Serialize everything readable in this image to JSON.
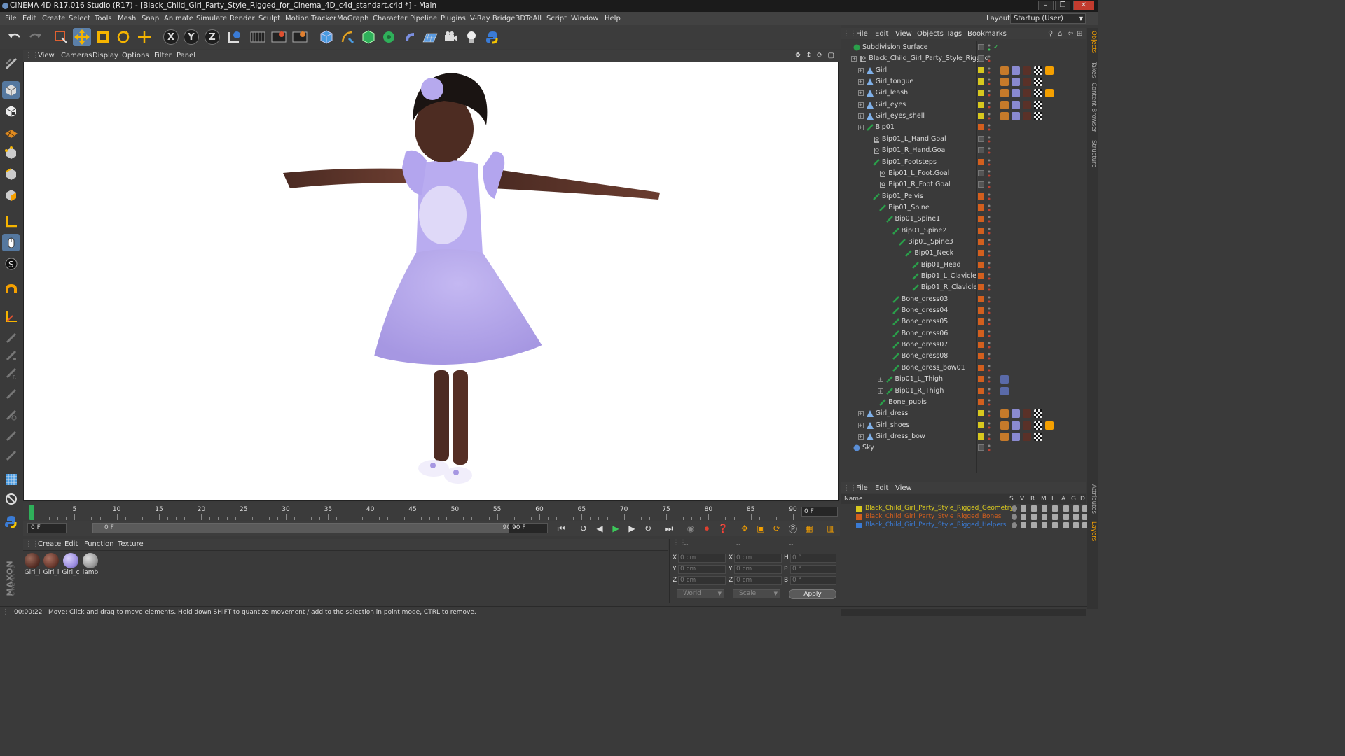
{
  "window": {
    "title": "CINEMA 4D R17.016 Studio (R17) - [Black_Child_Girl_Party_Style_Rigged_for_Cinema_4D_c4d_standart.c4d *] - Main",
    "minimize": "–",
    "maximize": "❐",
    "close": "✕"
  },
  "menubar": {
    "items": [
      "File",
      "Edit",
      "Create",
      "Select",
      "Tools",
      "Mesh",
      "Snap",
      "Animate",
      "Simulate",
      "Render",
      "Sculpt",
      "Motion Tracker",
      "MoGraph",
      "Character",
      "Pipeline",
      "Plugins",
      "V-Ray Bridge",
      "3DToAll",
      "Script",
      "Window",
      "Help"
    ],
    "layout_label": "Layout:",
    "layout_value": "Startup (User)"
  },
  "toolbar": {
    "axis_x": "X",
    "axis_y": "Y",
    "axis_z": "Z"
  },
  "viewport": {
    "menu": [
      "View",
      "Cameras",
      "Display",
      "Options",
      "Filter",
      "Panel"
    ]
  },
  "timeline": {
    "tick_labels": [
      "0",
      "5",
      "10",
      "15",
      "20",
      "25",
      "30",
      "35",
      "40",
      "45",
      "50",
      "55",
      "60",
      "65",
      "70",
      "75",
      "80",
      "85",
      "90"
    ],
    "current_frame": "0 F",
    "start_frame": "0 F",
    "range_start": "0 F",
    "range_end": "90 F",
    "end_frame": "90 F"
  },
  "material_manager": {
    "menu": [
      "Create",
      "Edit",
      "Function",
      "Texture"
    ],
    "materials": [
      {
        "label": "Girl_l",
        "color": "#5a3128"
      },
      {
        "label": "Girl_l",
        "color": "#6b3a2f"
      },
      {
        "label": "Girl_c",
        "color": "#9d8fe0"
      },
      {
        "label": "lamb",
        "color": "#9a9a9a"
      }
    ]
  },
  "coordinates": {
    "header": [
      "--",
      "--",
      "--"
    ],
    "rows": [
      {
        "a": "X",
        "av": "0 cm",
        "b": "X",
        "bv": "0 cm",
        "c": "H",
        "cv": "0 °"
      },
      {
        "a": "Y",
        "av": "0 cm",
        "b": "Y",
        "bv": "0 cm",
        "c": "P",
        "cv": "0 °"
      },
      {
        "a": "Z",
        "av": "0 cm",
        "b": "Z",
        "bv": "0 cm",
        "c": "B",
        "cv": "0 °"
      }
    ],
    "mode_world": "World",
    "mode_scale": "Scale",
    "apply": "Apply"
  },
  "status": {
    "time": "00:00:22",
    "message": "Move: Click and drag to move elements. Hold down SHIFT to quantize movement / add to the selection in point mode, CTRL to remove."
  },
  "object_manager": {
    "menu": [
      "File",
      "Edit",
      "View",
      "Objects",
      "Tags",
      "Bookmarks"
    ],
    "objects": [
      {
        "name": "Subdivision Surface",
        "indent": 0,
        "icon": "subdivision-icon",
        "color": "#2a9f4a",
        "layer": "none",
        "check": true
      },
      {
        "name": "Black_Child_Girl_Party_Style_Rigged",
        "indent": 1,
        "icon": "null-icon",
        "color": "#cfcfcf",
        "layer": "none"
      },
      {
        "name": "Girl",
        "indent": 2,
        "icon": "polygon-icon",
        "color": "#7fb0e8",
        "layer": "#d8c81e",
        "tags": 5
      },
      {
        "name": "Girl_tongue",
        "indent": 2,
        "icon": "polygon-icon",
        "color": "#7fb0e8",
        "layer": "#d8c81e",
        "tags": 4
      },
      {
        "name": "Girl_leash",
        "indent": 2,
        "icon": "polygon-icon",
        "color": "#7fb0e8",
        "layer": "#d8c81e",
        "tags": 5
      },
      {
        "name": "Girl_eyes",
        "indent": 2,
        "icon": "polygon-icon",
        "color": "#7fb0e8",
        "layer": "#d8c81e",
        "tags": 4
      },
      {
        "name": "Girl_eyes_shell",
        "indent": 2,
        "icon": "polygon-icon",
        "color": "#7fb0e8",
        "layer": "#d8c81e",
        "tags": 4
      },
      {
        "name": "Bip01",
        "indent": 2,
        "icon": "bone-icon",
        "color": "#2a9f4a",
        "layer": "#d35f1e"
      },
      {
        "name": "Bip01_L_Hand.Goal",
        "indent": 3,
        "icon": "null-icon",
        "color": "#cfcfcf",
        "layer": "none"
      },
      {
        "name": "Bip01_R_Hand.Goal",
        "indent": 3,
        "icon": "null-icon",
        "color": "#cfcfcf",
        "layer": "none"
      },
      {
        "name": "Bip01_Footsteps",
        "indent": 3,
        "icon": "bone-icon",
        "color": "#2a9f4a",
        "layer": "#d35f1e"
      },
      {
        "name": "Bip01_L_Foot.Goal",
        "indent": 4,
        "icon": "null-icon",
        "color": "#cfcfcf",
        "layer": "none"
      },
      {
        "name": "Bip01_R_Foot.Goal",
        "indent": 4,
        "icon": "null-icon",
        "color": "#cfcfcf",
        "layer": "none"
      },
      {
        "name": "Bip01_Pelvis",
        "indent": 3,
        "icon": "bone-icon",
        "color": "#2a9f4a",
        "layer": "#d35f1e"
      },
      {
        "name": "Bip01_Spine",
        "indent": 4,
        "icon": "bone-icon",
        "color": "#2a9f4a",
        "layer": "#d35f1e"
      },
      {
        "name": "Bip01_Spine1",
        "indent": 5,
        "icon": "bone-icon",
        "color": "#2a9f4a",
        "layer": "#d35f1e"
      },
      {
        "name": "Bip01_Spine2",
        "indent": 6,
        "icon": "bone-icon",
        "color": "#2a9f4a",
        "layer": "#d35f1e"
      },
      {
        "name": "Bip01_Spine3",
        "indent": 7,
        "icon": "bone-icon",
        "color": "#2a9f4a",
        "layer": "#d35f1e"
      },
      {
        "name": "Bip01_Neck",
        "indent": 8,
        "icon": "bone-icon",
        "color": "#2a9f4a",
        "layer": "#d35f1e"
      },
      {
        "name": "Bip01_Head",
        "indent": 9,
        "icon": "bone-icon",
        "color": "#2a9f4a",
        "layer": "#d35f1e"
      },
      {
        "name": "Bip01_L_Clavicle",
        "indent": 9,
        "icon": "bone-icon",
        "color": "#2a9f4a",
        "layer": "#d35f1e"
      },
      {
        "name": "Bip01_R_Clavicle",
        "indent": 9,
        "icon": "bone-icon",
        "color": "#2a9f4a",
        "layer": "#d35f1e"
      },
      {
        "name": "Bone_dress03",
        "indent": 6,
        "icon": "bone-icon",
        "color": "#2a9f4a",
        "layer": "#d35f1e"
      },
      {
        "name": "Bone_dress04",
        "indent": 6,
        "icon": "bone-icon",
        "color": "#2a9f4a",
        "layer": "#d35f1e"
      },
      {
        "name": "Bone_dress05",
        "indent": 6,
        "icon": "bone-icon",
        "color": "#2a9f4a",
        "layer": "#d35f1e"
      },
      {
        "name": "Bone_dress06",
        "indent": 6,
        "icon": "bone-icon",
        "color": "#2a9f4a",
        "layer": "#d35f1e"
      },
      {
        "name": "Bone_dress07",
        "indent": 6,
        "icon": "bone-icon",
        "color": "#2a9f4a",
        "layer": "#d35f1e"
      },
      {
        "name": "Bone_dress08",
        "indent": 6,
        "icon": "bone-icon",
        "color": "#2a9f4a",
        "layer": "#d35f1e"
      },
      {
        "name": "Bone_dress_bow01",
        "indent": 6,
        "icon": "bone-icon",
        "color": "#2a9f4a",
        "layer": "#d35f1e"
      },
      {
        "name": "Bip01_L_Thigh",
        "indent": 5,
        "icon": "bone-icon",
        "color": "#2a9f4a",
        "layer": "#d35f1e",
        "tags": 1
      },
      {
        "name": "Bip01_R_Thigh",
        "indent": 5,
        "icon": "bone-icon",
        "color": "#2a9f4a",
        "layer": "#d35f1e",
        "tags": 1
      },
      {
        "name": "Bone_pubis",
        "indent": 4,
        "icon": "bone-icon",
        "color": "#2a9f4a",
        "layer": "#d35f1e"
      },
      {
        "name": "Girl_dress",
        "indent": 2,
        "icon": "polygon-icon",
        "color": "#7fb0e8",
        "layer": "#d8c81e",
        "tags": 4
      },
      {
        "name": "Girl_shoes",
        "indent": 2,
        "icon": "polygon-icon",
        "color": "#7fb0e8",
        "layer": "#d8c81e",
        "tags": 5
      },
      {
        "name": "Girl_dress_bow",
        "indent": 2,
        "icon": "polygon-icon",
        "color": "#7fb0e8",
        "layer": "#d8c81e",
        "tags": 4
      },
      {
        "name": "Sky",
        "indent": 0,
        "icon": "sky-icon",
        "color": "#5a8ed6",
        "layer": "none"
      }
    ]
  },
  "layer_manager": {
    "menu": [
      "File",
      "Edit",
      "View"
    ],
    "columns": [
      "Name",
      "S",
      "V",
      "R",
      "M",
      "L",
      "A",
      "G",
      "D"
    ],
    "layers": [
      {
        "name": "Black_Child_Girl_Party_Style_Rigged_Geometry",
        "color": "#d8c81e"
      },
      {
        "name": "Black_Child_Girl_Party_Style_Rigged_Bones",
        "color": "#d35f1e"
      },
      {
        "name": "Black_Child_Girl_Party_Style_Rigged_Helpers",
        "color": "#3a7bd5"
      }
    ]
  },
  "right_tabs": [
    "Objects",
    "Takes",
    "Content Browser",
    "Structure",
    "Attributes",
    "Layers"
  ]
}
